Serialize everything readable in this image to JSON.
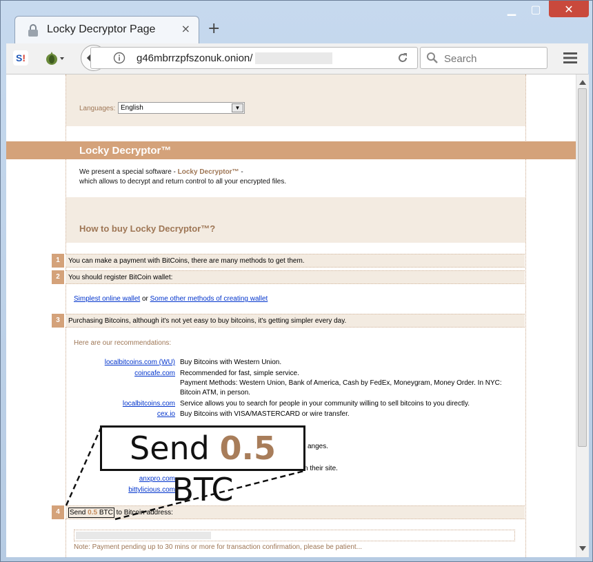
{
  "browser": {
    "tab_title": "Locky Decryptor Page",
    "tab_close": "×",
    "new_tab": "+",
    "url": "g46mbrrzpfszonuk.onion/",
    "search_placeholder": "Search",
    "win_min": "▁",
    "win_max": "▢",
    "win_close": "✕"
  },
  "page": {
    "languages_label": "Languages:",
    "language_selected": "English",
    "banner_title": "Locky Decryptor™",
    "intro_line1_a": "We present a special software - ",
    "intro_product": "Locky Decryptor™",
    "intro_line1_b": " -",
    "intro_line2": "which allows to decrypt and return control to all your encrypted files.",
    "howto_title": "How to buy Locky Decryptor™?",
    "steps": [
      {
        "num": "1",
        "text": "You can make a payment with BitCoins, there are many methods to get them."
      },
      {
        "num": "2",
        "text": "You should register BitCoin wallet:"
      },
      {
        "num": "3",
        "text": "Purchasing Bitcoins, although it's not yet easy to buy bitcoins, it's getting simpler every day."
      },
      {
        "num": "4",
        "text_a": "Send ",
        "amount": "0.5",
        "text_b": " BTC",
        "text_c": " to Bitcoin address:"
      }
    ],
    "wallet_link1": "Simplest online wallet",
    "wallet_or": "or",
    "wallet_link2": "Some other methods of creating wallet",
    "recommend_title": "Here are our recommendations:",
    "recommendations": [
      {
        "site": "localbitcoins.com (WU)",
        "desc": "Buy Bitcoins with Western Union."
      },
      {
        "site": "coincafe.com",
        "desc": "Recommended for fast, simple service."
      },
      {
        "site": "",
        "desc": "Payment Methods: Western Union, Bank of America, Cash by FedEx, Moneygram, Money Order. In NYC:"
      },
      {
        "site": "",
        "desc": "Bitcoin ATM, in person."
      },
      {
        "site": "localbitcoins.com",
        "desc": "Service allows you to search for people in your community willing to sell bitcoins to you directly."
      },
      {
        "site": "cex.io",
        "desc": "Buy Bitcoins with VISA/MASTERCARD or wire transfer."
      }
    ],
    "partial_desc1": "anges.",
    "partial_desc2": "n their site.",
    "more_sites": [
      "anxpro.com",
      "bittylicious.com"
    ],
    "callout_a": "Send ",
    "callout_amount": "0.5",
    "callout_b": " BTC",
    "note": "Note: Payment pending up to 30 mins or more for transaction confirmation, please be patient..."
  },
  "colors": {
    "accent": "#d4a27a",
    "accent_text": "#9e7655",
    "beige": "#f3ebe1",
    "link": "#0033cc"
  }
}
